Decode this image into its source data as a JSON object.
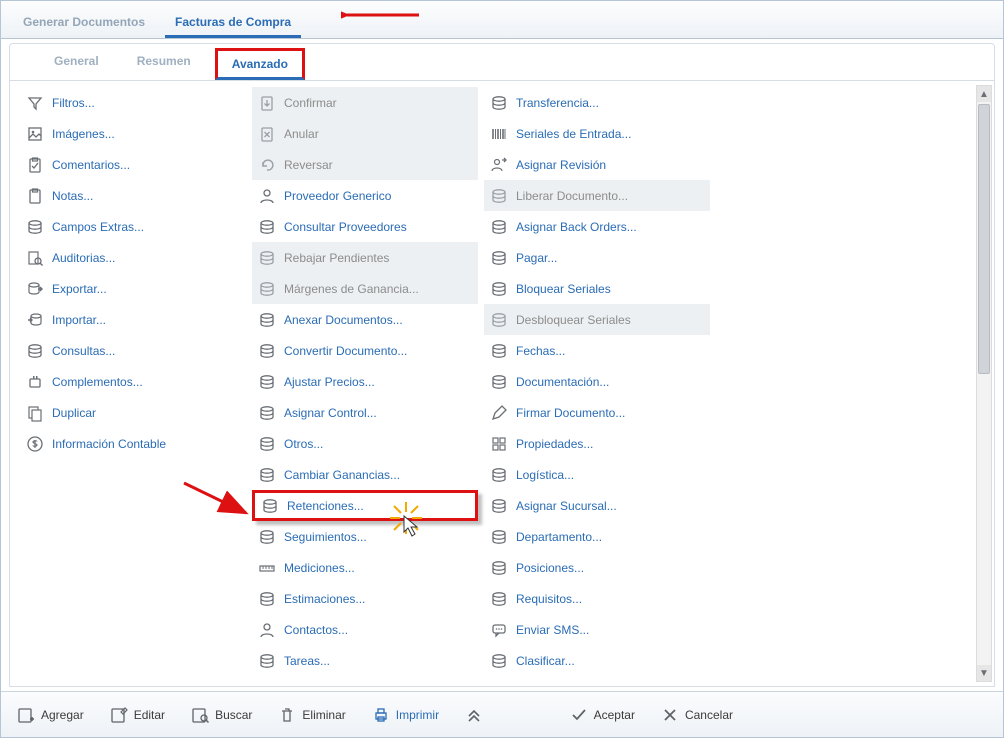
{
  "top_tabs": {
    "generate": "Generar Documentos",
    "purchase": "Facturas de Compra"
  },
  "sub_tabs": {
    "general": "General",
    "resumen": "Resumen",
    "avanzado": "Avanzado"
  },
  "col1": [
    {
      "k": "filtros",
      "label": "Filtros...",
      "icon": "funnel",
      "d": false
    },
    {
      "k": "imagenes",
      "label": "Imágenes...",
      "icon": "image",
      "d": false
    },
    {
      "k": "comentarios",
      "label": "Comentarios...",
      "icon": "clipboard-check",
      "d": false
    },
    {
      "k": "notas",
      "label": "Notas...",
      "icon": "clipboard",
      "d": false
    },
    {
      "k": "campos",
      "label": "Campos Extras...",
      "icon": "db",
      "d": false
    },
    {
      "k": "auditorias",
      "label": "Auditorias...",
      "icon": "audit",
      "d": false
    },
    {
      "k": "exportar",
      "label": "Exportar...",
      "icon": "export",
      "d": false
    },
    {
      "k": "importar",
      "label": "Importar...",
      "icon": "import",
      "d": false
    },
    {
      "k": "consultas",
      "label": "Consultas...",
      "icon": "db",
      "d": false
    },
    {
      "k": "complementos",
      "label": "Complementos...",
      "icon": "plugin",
      "d": false
    },
    {
      "k": "duplicar",
      "label": "Duplicar",
      "icon": "copy",
      "d": false
    },
    {
      "k": "infocont",
      "label": "Información Contable",
      "icon": "dollar",
      "d": false
    }
  ],
  "col2": [
    {
      "k": "confirmar",
      "label": "Confirmar",
      "icon": "clip-down",
      "d": true
    },
    {
      "k": "anular",
      "label": "Anular",
      "icon": "clip-x",
      "d": true
    },
    {
      "k": "reversar",
      "label": "Reversar",
      "icon": "undo",
      "d": true
    },
    {
      "k": "provgen",
      "label": "Proveedor Generico",
      "icon": "person",
      "d": false
    },
    {
      "k": "consprov",
      "label": "Consultar Proveedores",
      "icon": "db",
      "d": false
    },
    {
      "k": "rebajar",
      "label": "Rebajar Pendientes",
      "icon": "db",
      "d": true
    },
    {
      "k": "margenes",
      "label": "Márgenes de Ganancia...",
      "icon": "db",
      "d": true
    },
    {
      "k": "anexar",
      "label": "Anexar Documentos...",
      "icon": "db",
      "d": false
    },
    {
      "k": "convertir",
      "label": "Convertir Documento...",
      "icon": "db",
      "d": false
    },
    {
      "k": "ajustar",
      "label": "Ajustar Precios...",
      "icon": "db",
      "d": false
    },
    {
      "k": "asignarctrl",
      "label": "Asignar Control...",
      "icon": "db",
      "d": false
    },
    {
      "k": "otros",
      "label": "Otros...",
      "icon": "db",
      "d": false
    },
    {
      "k": "cambiargan",
      "label": "Cambiar Ganancias...",
      "icon": "db",
      "d": false
    },
    {
      "k": "retenciones",
      "label": "Retenciones...",
      "icon": "db",
      "d": false,
      "hl": true
    },
    {
      "k": "seguimientos",
      "label": "Seguimientos...",
      "icon": "db",
      "d": false
    },
    {
      "k": "mediciones",
      "label": "Mediciones...",
      "icon": "ruler",
      "d": false
    },
    {
      "k": "estimaciones",
      "label": "Estimaciones...",
      "icon": "db",
      "d": false
    },
    {
      "k": "contactos",
      "label": "Contactos...",
      "icon": "person",
      "d": false
    },
    {
      "k": "tareas",
      "label": "Tareas...",
      "icon": "db",
      "d": false
    }
  ],
  "col3": [
    {
      "k": "transferencia",
      "label": "Transferencia...",
      "icon": "db",
      "d": false
    },
    {
      "k": "seriales",
      "label": "Seriales de Entrada...",
      "icon": "barcode",
      "d": false
    },
    {
      "k": "asignarrev",
      "label": "Asignar Revisión",
      "icon": "user-assign",
      "d": false
    },
    {
      "k": "liberar",
      "label": "Liberar Documento...",
      "icon": "db",
      "d": true
    },
    {
      "k": "backorders",
      "label": "Asignar Back Orders...",
      "icon": "db",
      "d": false
    },
    {
      "k": "pagar",
      "label": "Pagar...",
      "icon": "db",
      "d": false
    },
    {
      "k": "bloqser",
      "label": "Bloquear Seriales",
      "icon": "db",
      "d": false
    },
    {
      "k": "desbloqser",
      "label": "Desbloquear Seriales",
      "icon": "db",
      "d": true
    },
    {
      "k": "fechas",
      "label": "Fechas...",
      "icon": "db",
      "d": false
    },
    {
      "k": "documentacion",
      "label": "Documentación...",
      "icon": "db",
      "d": false
    },
    {
      "k": "firmar",
      "label": "Firmar Documento...",
      "icon": "pen",
      "d": false
    },
    {
      "k": "propiedades",
      "label": "Propiedades...",
      "icon": "grid",
      "d": false
    },
    {
      "k": "logistica",
      "label": "Logística...",
      "icon": "db",
      "d": false
    },
    {
      "k": "asignarsuc",
      "label": "Asignar Sucursal...",
      "icon": "db",
      "d": false
    },
    {
      "k": "departamento",
      "label": "Departamento...",
      "icon": "db",
      "d": false
    },
    {
      "k": "posiciones",
      "label": "Posiciones...",
      "icon": "db",
      "d": false
    },
    {
      "k": "requisitos",
      "label": "Requisitos...",
      "icon": "db",
      "d": false
    },
    {
      "k": "enviarsms",
      "label": "Enviar SMS...",
      "icon": "sms",
      "d": false
    },
    {
      "k": "clasificar",
      "label": "Clasificar...",
      "icon": "db",
      "d": false
    }
  ],
  "bottom": {
    "agregar": "Agregar",
    "editar": "Editar",
    "buscar": "Buscar",
    "eliminar": "Eliminar",
    "imprimir": "Imprimir",
    "aceptar": "Aceptar",
    "cancelar": "Cancelar"
  }
}
